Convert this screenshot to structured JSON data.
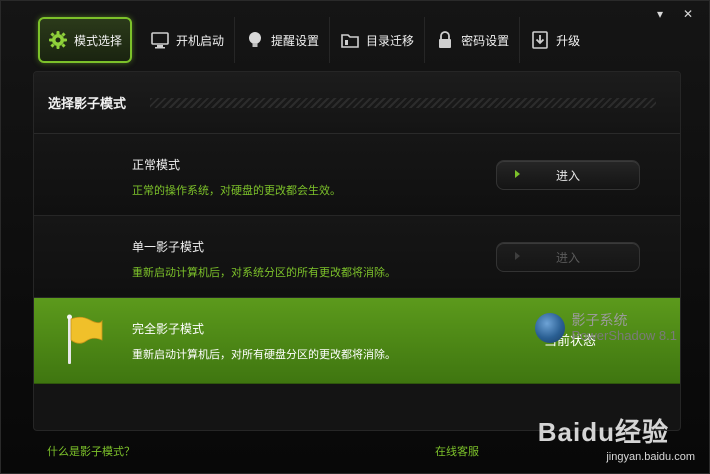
{
  "window": {
    "minimize_label": "▾",
    "close_label": "✕"
  },
  "toolbar": {
    "tabs": [
      {
        "label": "模式选择",
        "icon": "gear-icon",
        "active": true
      },
      {
        "label": "开机启动",
        "icon": "monitor-icon"
      },
      {
        "label": "提醒设置",
        "icon": "bulb-icon"
      },
      {
        "label": "目录迁移",
        "icon": "folder-icon"
      },
      {
        "label": "密码设置",
        "icon": "lock-icon"
      },
      {
        "label": "升级",
        "icon": "upgrade-icon"
      }
    ]
  },
  "panel": {
    "title": "选择影子模式",
    "modes": [
      {
        "title": "正常模式",
        "desc": "正常的操作系统，对硬盘的更改都会生效。",
        "button": "进入"
      },
      {
        "title": "单一影子模式",
        "desc": "重新启动计算机后，对系统分区的所有更改都将消除。",
        "button": "进入",
        "disabled": true
      },
      {
        "title": "完全影子模式",
        "desc": "重新启动计算机后，对所有硬盘分区的更改都将消除。",
        "status": "当前状态",
        "current": true
      }
    ]
  },
  "brand": {
    "name_cn": "影子系统",
    "name_en": "PowerShadow 8.1"
  },
  "footer": {
    "help_link": "什么是影子模式？",
    "support_link": "在线客服"
  },
  "watermark": {
    "logo": "Baidu经验",
    "url": "jingyan.baidu.com"
  },
  "colors": {
    "accent": "#7cc12a",
    "current_bg": "#4f8a17",
    "background": "#0d0d0d"
  }
}
